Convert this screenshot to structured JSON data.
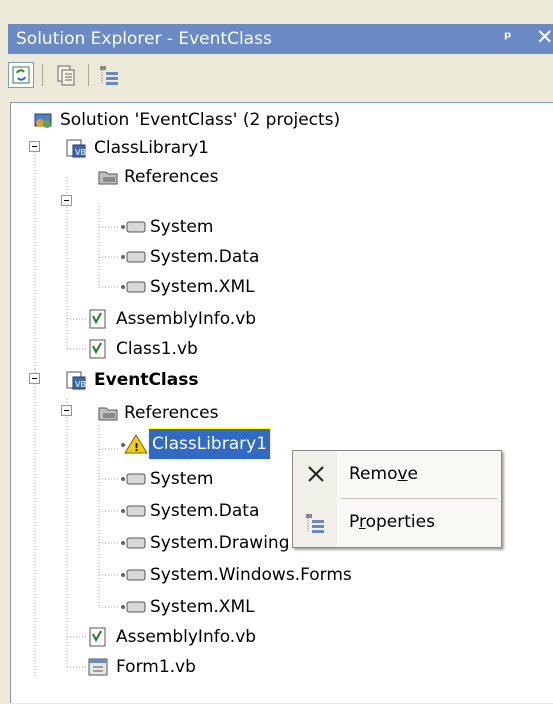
{
  "window": {
    "title": "Solution Explorer - EventClass",
    "pin_glyph": "ᵖ",
    "close_glyph": "✕"
  },
  "toolbar": {
    "buttons": [
      {
        "icon": "refresh-icon",
        "pressed": true
      },
      {
        "icon": "show-all-files-icon",
        "pressed": false
      },
      {
        "icon": "properties-icon",
        "pressed": false
      }
    ]
  },
  "tree": {
    "solution": "Solution 'EventClass' (2 projects)",
    "project1": {
      "name": "ClassLibrary1",
      "references_label": "References",
      "references": [
        "System",
        "System.Data",
        "System.XML"
      ],
      "files": [
        "AssemblyInfo.vb",
        "Class1.vb"
      ]
    },
    "project2": {
      "name": "EventClass",
      "references_label": "References",
      "references": [
        "ClassLibrary1",
        "System",
        "System.Data",
        "System.Drawing",
        "System.Windows.Forms",
        "System.XML"
      ],
      "files": [
        "AssemblyInfo.vb",
        "Form1.vb"
      ]
    }
  },
  "context_menu": {
    "remove_pre": "Remo",
    "remove_access": "v",
    "remove_post": "e",
    "properties_pre": "P",
    "properties_access": "r",
    "properties_post": "operties"
  },
  "colors": {
    "selection": "#316AC5",
    "titlebar": "#6A8AC6",
    "window_bg": "#ECE9D8"
  }
}
